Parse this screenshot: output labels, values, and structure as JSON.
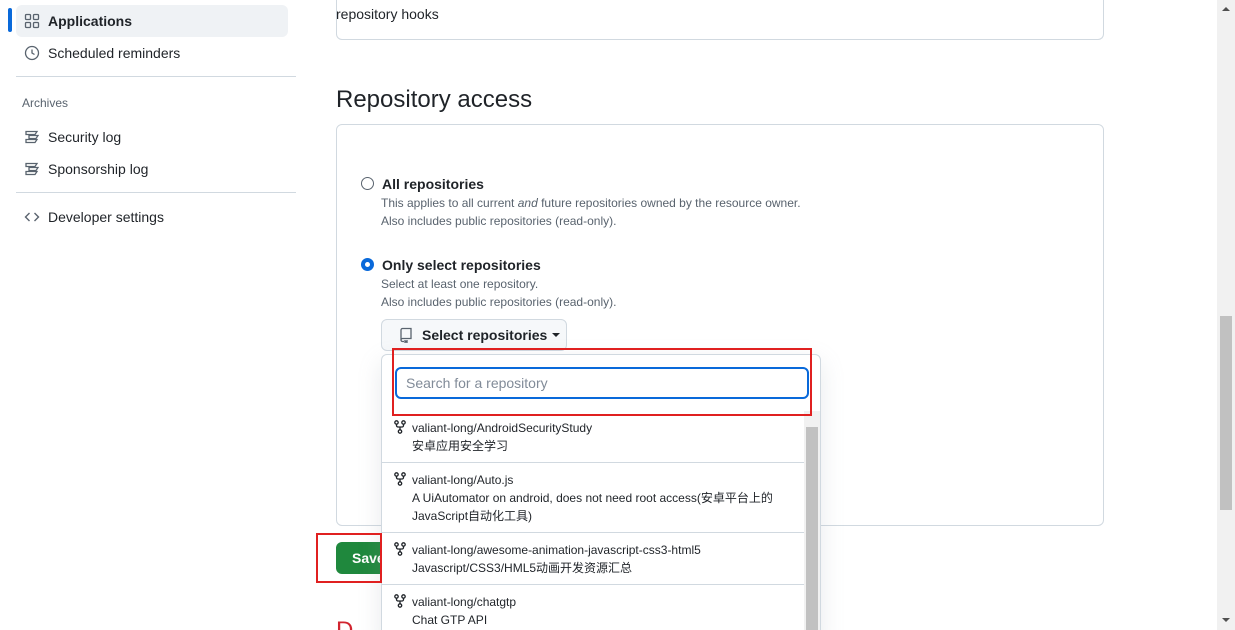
{
  "sidebar": {
    "items": [
      {
        "label": "Applications",
        "icon": "apps-icon",
        "active": true
      },
      {
        "label": "Scheduled reminders",
        "icon": "clock-icon"
      }
    ],
    "archives_heading": "Archives",
    "archive_items": [
      {
        "label": "Security log",
        "icon": "log-icon"
      },
      {
        "label": "Sponsorship log",
        "icon": "log-icon"
      }
    ],
    "developer_settings": {
      "label": "Developer settings",
      "icon": "code-icon"
    }
  },
  "main": {
    "hooks_text": "repository hooks",
    "section_title": "Repository access",
    "options": [
      {
        "label": "All repositories",
        "checked": false,
        "note_line1": "This applies to all current and future repositories owned by the resource owner.",
        "note_line2": "Also includes public repositories (read-only)."
      },
      {
        "label": "Only select repositories",
        "checked": true,
        "note_line1": "Select at least one repository.",
        "note_line2": "Also includes public repositories (read-only)."
      }
    ],
    "select_button": "Select repositories",
    "dropdown": {
      "search_placeholder": "Search for a repository",
      "repos": [
        {
          "name": "valiant-long/AndroidSecurityStudy",
          "description": "安卓应用安全学习"
        },
        {
          "name": "valiant-long/Auto.js",
          "description": "A UiAutomator on android, does not need root access(安卓平台上的JavaScript自动化工具)"
        },
        {
          "name": "valiant-long/awesome-animation-javascript-css3-html5",
          "description": "Javascript/CSS3/HML5动画开发资源汇总"
        },
        {
          "name": "valiant-long/chatgtp",
          "description": "Chat GTP API"
        }
      ]
    },
    "save_label": "Save",
    "danger_partial": "D"
  },
  "colors": {
    "accent": "#0969da",
    "save_green": "#1f883d",
    "annotation_red": "#e02020",
    "danger_red": "#d1242f"
  }
}
